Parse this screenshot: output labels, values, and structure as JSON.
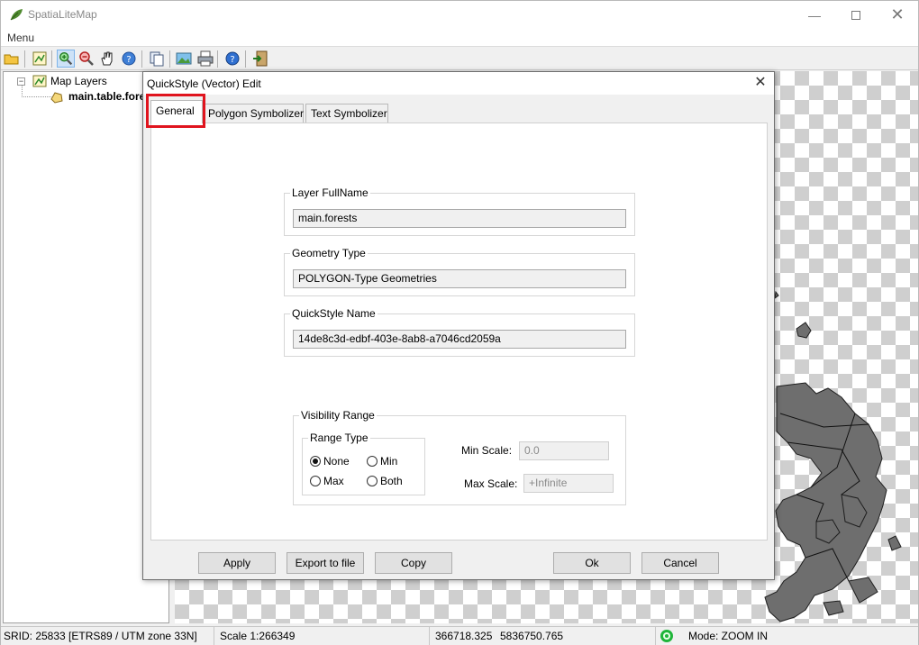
{
  "app": {
    "title": "SpatiaLiteMap"
  },
  "menubar": {
    "menu_label": "Menu"
  },
  "toolbar": {
    "buttons": [
      "open-icon",
      "add-layer-icon",
      "zoom-in-icon",
      "zoom-out-icon",
      "pan-icon",
      "identify-icon",
      "copy-map-icon",
      "export-image-icon",
      "print-icon",
      "about-icon",
      "exit-icon"
    ],
    "active": "zoom-in-icon"
  },
  "tree": {
    "root_label": "Map Layers",
    "child_label": "main.table.forests"
  },
  "dialog": {
    "title": "QuickStyle (Vector) Edit",
    "tabs": [
      {
        "label": "General",
        "selected": true
      },
      {
        "label": "Polygon Symbolizer",
        "selected": false
      },
      {
        "label": "Text Symbolizer",
        "selected": false
      }
    ],
    "layer_fullname": {
      "label": "Layer FullName",
      "value": "main.forests"
    },
    "geometry_type": {
      "label": "Geometry Type",
      "value": "POLYGON-Type Geometries"
    },
    "quickstyle_name": {
      "label": "QuickStyle Name",
      "value": "14de8c3d-edbf-403e-8ab8-a7046cd2059a"
    },
    "visibility": {
      "label": "Visibility Range",
      "range_type_label": "Range Type",
      "options": {
        "none": "None",
        "min": "Min",
        "max": "Max",
        "both": "Both"
      },
      "selected": "None",
      "min_scale_label": "Min Scale:",
      "min_scale_value": "0.0",
      "max_scale_label": "Max Scale:",
      "max_scale_value": "+Infinite"
    },
    "buttons": {
      "apply": "Apply",
      "export": "Export to file",
      "copy": "Copy",
      "ok": "Ok",
      "cancel": "Cancel"
    }
  },
  "statusbar": {
    "srid": "SRID: 25833 [ETRS89 / UTM zone 33N]",
    "scale": "Scale 1:266349",
    "coord_x": "366718.325",
    "coord_y": "5836750.765",
    "mode": "Mode: ZOOM IN"
  },
  "colors": {
    "highlight": "#e0141e",
    "polygon_fill": "#6e6e6e",
    "status_ok": "#1fb53a"
  }
}
